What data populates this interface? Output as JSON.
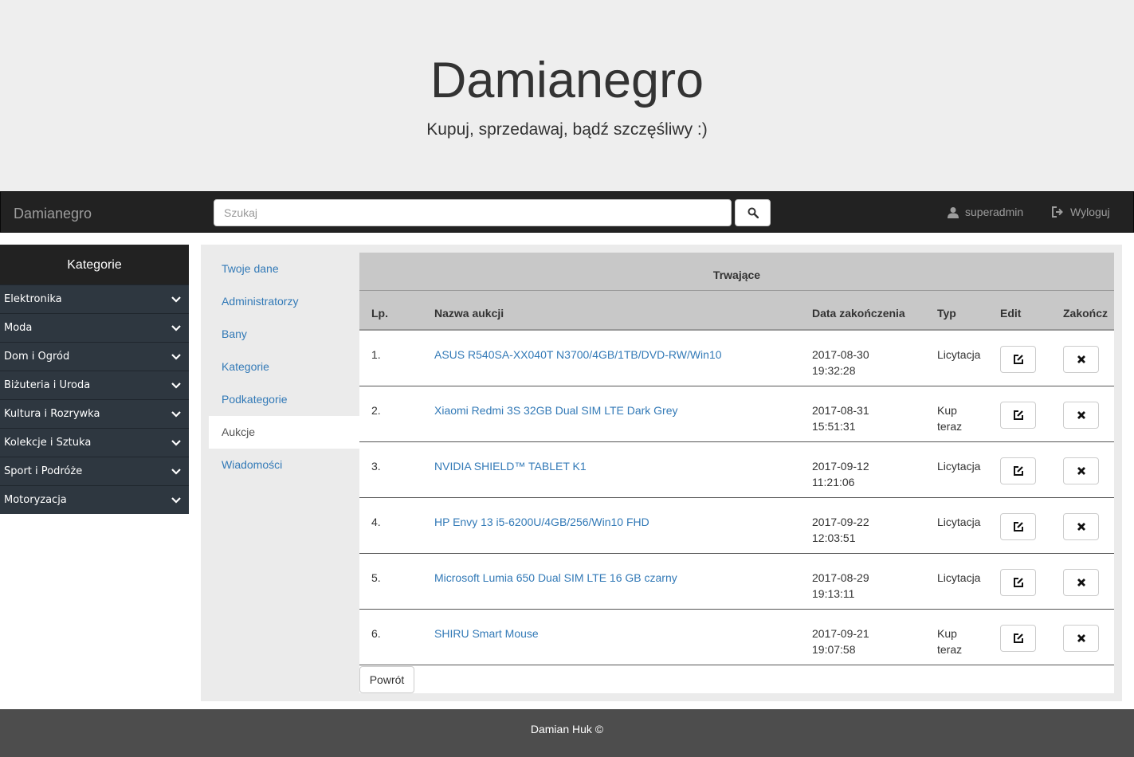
{
  "hero": {
    "title": "Damianegro",
    "subtitle": "Kupuj, sprzedawaj, bądź szczęśliwy :)"
  },
  "navbar": {
    "brand": "Damianegro",
    "search_placeholder": "Szukaj",
    "search_icon": "search-icon",
    "user": "superadmin",
    "logout": "Wyloguj"
  },
  "sidebar": {
    "heading": "Kategorie",
    "items": [
      "Elektronika",
      "Moda",
      "Dom i Ogród",
      "Biżuteria i Uroda",
      "Kultura i Rozrywka",
      "Kolekcje i Sztuka",
      "Sport i Podróże",
      "Motoryzacja"
    ]
  },
  "subnav": {
    "items": [
      "Twoje dane",
      "Administratorzy",
      "Bany",
      "Kategorie",
      "Podkategorie",
      "Aukcje",
      "Wiadomości"
    ],
    "active": "Aukcje"
  },
  "table": {
    "caption": "Trwające",
    "columns": [
      "Lp.",
      "Nazwa aukcji",
      "Data zakończenia",
      "Typ",
      "Edit",
      "Zakończ"
    ],
    "rows": [
      {
        "lp": "1.",
        "name": "ASUS R540SA-XX040T N3700/4GB/1TB/DVD-RW/Win10",
        "date": "2017-08-30",
        "time": "19:32:28",
        "type1": "Licytacja",
        "type2": ""
      },
      {
        "lp": "2.",
        "name": "Xiaomi Redmi 3S 32GB Dual SIM LTE Dark Grey",
        "date": "2017-08-31",
        "time": "15:51:31",
        "type1": "Kup",
        "type2": "teraz"
      },
      {
        "lp": "3.",
        "name": "NVIDIA SHIELD™ TABLET K1",
        "date": "2017-09-12",
        "time": "11:21:06",
        "type1": "Licytacja",
        "type2": ""
      },
      {
        "lp": "4.",
        "name": "HP Envy 13 i5-6200U/4GB/256/Win10 FHD",
        "date": "2017-09-22",
        "time": "12:03:51",
        "type1": "Licytacja",
        "type2": ""
      },
      {
        "lp": "5.",
        "name": "Microsoft Lumia 650 Dual SIM LTE 16 GB czarny",
        "date": "2017-08-29",
        "time": "19:13:11",
        "type1": "Licytacja",
        "type2": ""
      },
      {
        "lp": "6.",
        "name": "SHIRU Smart Mouse",
        "date": "2017-09-21",
        "time": "19:07:58",
        "type1": "Kup",
        "type2": "teraz"
      }
    ],
    "back_label": "Powrót"
  },
  "footer": {
    "text": "Damian Huk ©"
  }
}
